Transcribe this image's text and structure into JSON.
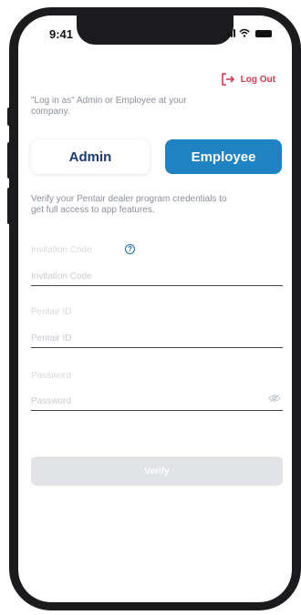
{
  "status_bar": {
    "time": "9:41"
  },
  "header": {
    "logout_label": "Log Out"
  },
  "intro_text": "\"Log in as\" Admin or Employee at your company.",
  "role_toggle": {
    "admin_label": "Admin",
    "employee_label": "Employee",
    "selected": "Employee"
  },
  "verify_text": "Verify your Pentair dealer program credentials to get full access to app features.",
  "fields": {
    "invitation": {
      "label": "Invitation Code",
      "placeholder": "Invitation Code"
    },
    "pentair_id": {
      "label": "Pentair ID",
      "placeholder": "Pentair ID"
    },
    "password": {
      "label": "Password",
      "placeholder": "Password"
    }
  },
  "verify_button": {
    "label": "Verify"
  },
  "colors": {
    "accent": "#1f82c3",
    "logout": "#d63650",
    "admin_text": "#1e3b6f",
    "disabled_button": "#e1e3e6"
  },
  "icons": {
    "logout": "logout-arrow-icon",
    "help": "question-circle-icon",
    "password_visibility": "eye-off-icon"
  }
}
